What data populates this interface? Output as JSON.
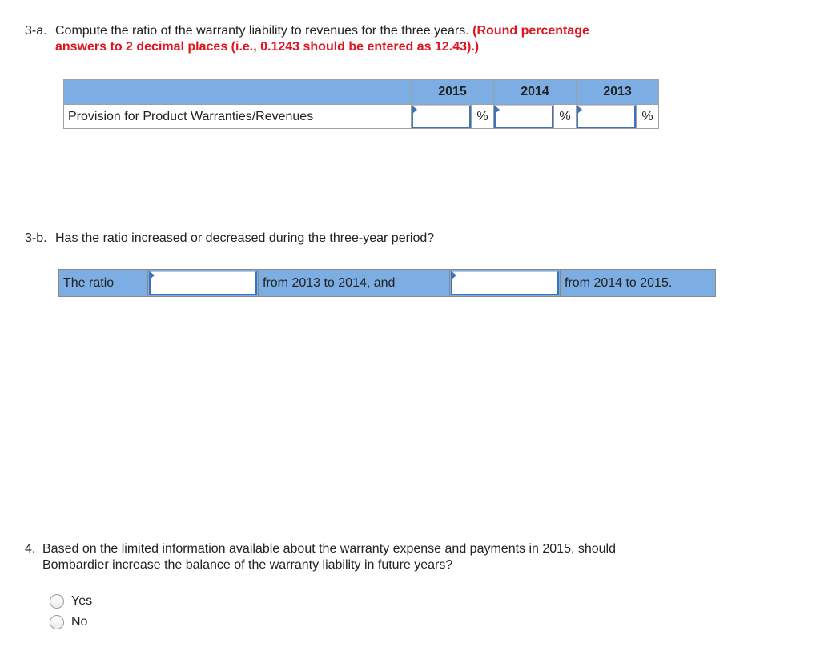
{
  "q3a": {
    "number": "3-a.",
    "text": "Compute the ratio of the warranty liability to revenues for the three years.",
    "instruction_line1": "(Round percentage",
    "instruction_line2": "answers to 2 decimal places (i.e., 0.1243 should be entered as 12.43).)",
    "table": {
      "header_blank": "",
      "years": [
        "2015",
        "2014",
        "2013"
      ],
      "row_label": "Provision for Product Warranties/Revenues",
      "unit": "%",
      "values": [
        "",
        "",
        ""
      ]
    }
  },
  "q3b": {
    "number": "3-b.",
    "text": "Has the ratio increased or decreased during the three-year period?",
    "sentence": {
      "part1": "The ratio",
      "select1_value": "",
      "part2": "from 2013 to 2014, and",
      "select2_value": "",
      "part3": "from 2014 to 2015."
    }
  },
  "q4": {
    "number": "4.",
    "text_line1": "Based on the limited information available about the warranty expense and payments in 2015, should",
    "text_line2": "Bombardier increase the balance of the warranty liability in future years?",
    "options": [
      "Yes",
      "No"
    ]
  },
  "colors": {
    "header_blue": "#7daee3",
    "input_border": "#3f73b8",
    "instruction_red": "#e0141e"
  }
}
